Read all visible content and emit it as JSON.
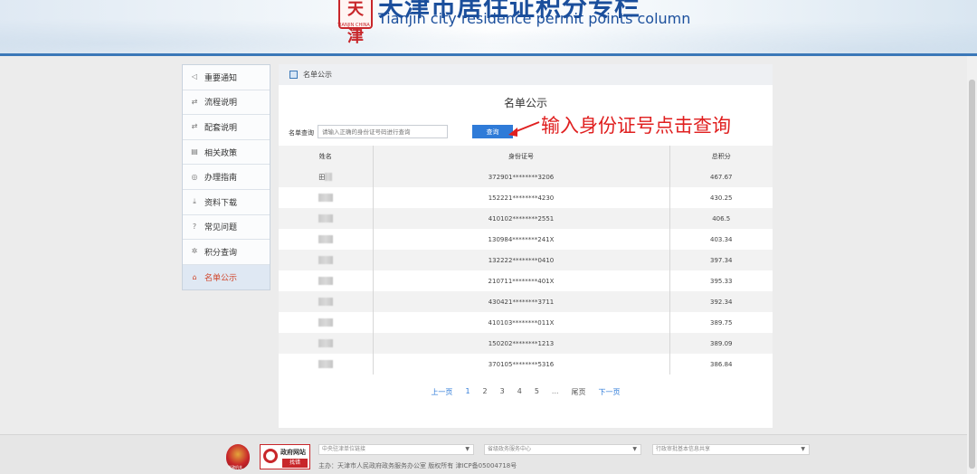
{
  "header": {
    "seal_text": "天津",
    "seal_sub": "TIANJIN CHINA",
    "title_cn": "天津市居住证积分专栏",
    "title_en": "Tianjin city residence permit points column"
  },
  "sidebar": {
    "items": [
      {
        "label": "重要通知",
        "icon": "speaker-icon",
        "glyph": "◁"
      },
      {
        "label": "流程说明",
        "icon": "flow-icon",
        "glyph": "⇄"
      },
      {
        "label": "配套说明",
        "icon": "link-icon",
        "glyph": "⇄"
      },
      {
        "label": "相关政策",
        "icon": "document-icon",
        "glyph": "▤"
      },
      {
        "label": "办理指南",
        "icon": "compass-icon",
        "glyph": "◎"
      },
      {
        "label": "资料下载",
        "icon": "download-icon",
        "glyph": "⤓"
      },
      {
        "label": "常见问题",
        "icon": "question-icon",
        "glyph": "?"
      },
      {
        "label": "积分查询",
        "icon": "gear-icon",
        "glyph": "✲"
      },
      {
        "label": "名单公示",
        "icon": "list-icon",
        "glyph": "⌂"
      }
    ]
  },
  "panel": {
    "breadcrumb": "名单公示",
    "title": "名单公示",
    "search_label": "名单查询",
    "search_placeholder": "请输入正确的身份证号码进行查询",
    "search_button": "查询",
    "annotation": "输入身份证号点击查询"
  },
  "table": {
    "headers": [
      "姓名",
      "身份证号",
      "总积分"
    ],
    "rows": [
      {
        "name_prefix": "田",
        "id": "372901********3206",
        "score": "467.67"
      },
      {
        "name_prefix": "",
        "id": "152221********4230",
        "score": "430.25"
      },
      {
        "name_prefix": "",
        "id": "410102********2551",
        "score": "406.5"
      },
      {
        "name_prefix": "",
        "id": "130984********241X",
        "score": "403.34"
      },
      {
        "name_prefix": "",
        "id": "132222********0410",
        "score": "397.34"
      },
      {
        "name_prefix": "",
        "id": "210711********401X",
        "score": "395.33"
      },
      {
        "name_prefix": "",
        "id": "430421********3711",
        "score": "392.34"
      },
      {
        "name_prefix": "",
        "id": "410103********011X",
        "score": "389.75"
      },
      {
        "name_prefix": "",
        "id": "150202********1213",
        "score": "389.09"
      },
      {
        "name_prefix": "",
        "id": "370105********5316",
        "score": "386.84"
      }
    ]
  },
  "pagination": {
    "prev": "上一页",
    "pages": [
      "1",
      "2",
      "3",
      "4",
      "5"
    ],
    "ellipsis": "...",
    "last": "尾页",
    "next": "下一页"
  },
  "footer": {
    "emblem_text": "党政机关",
    "find_top": "政府网站",
    "find_bottom": "找错",
    "select1": "中央驻津单位链接",
    "select2": "省级政务服务中心",
    "select3": "行政审批基本信息共享",
    "copyright": "主办：天津市人民政府政务服务办公室 版权所有 津ICP备05004718号"
  },
  "colors": {
    "accent": "#2f7bd8",
    "active_text": "#d0452a",
    "annotation": "#e02020",
    "brand_blue": "#1b4f9c"
  }
}
